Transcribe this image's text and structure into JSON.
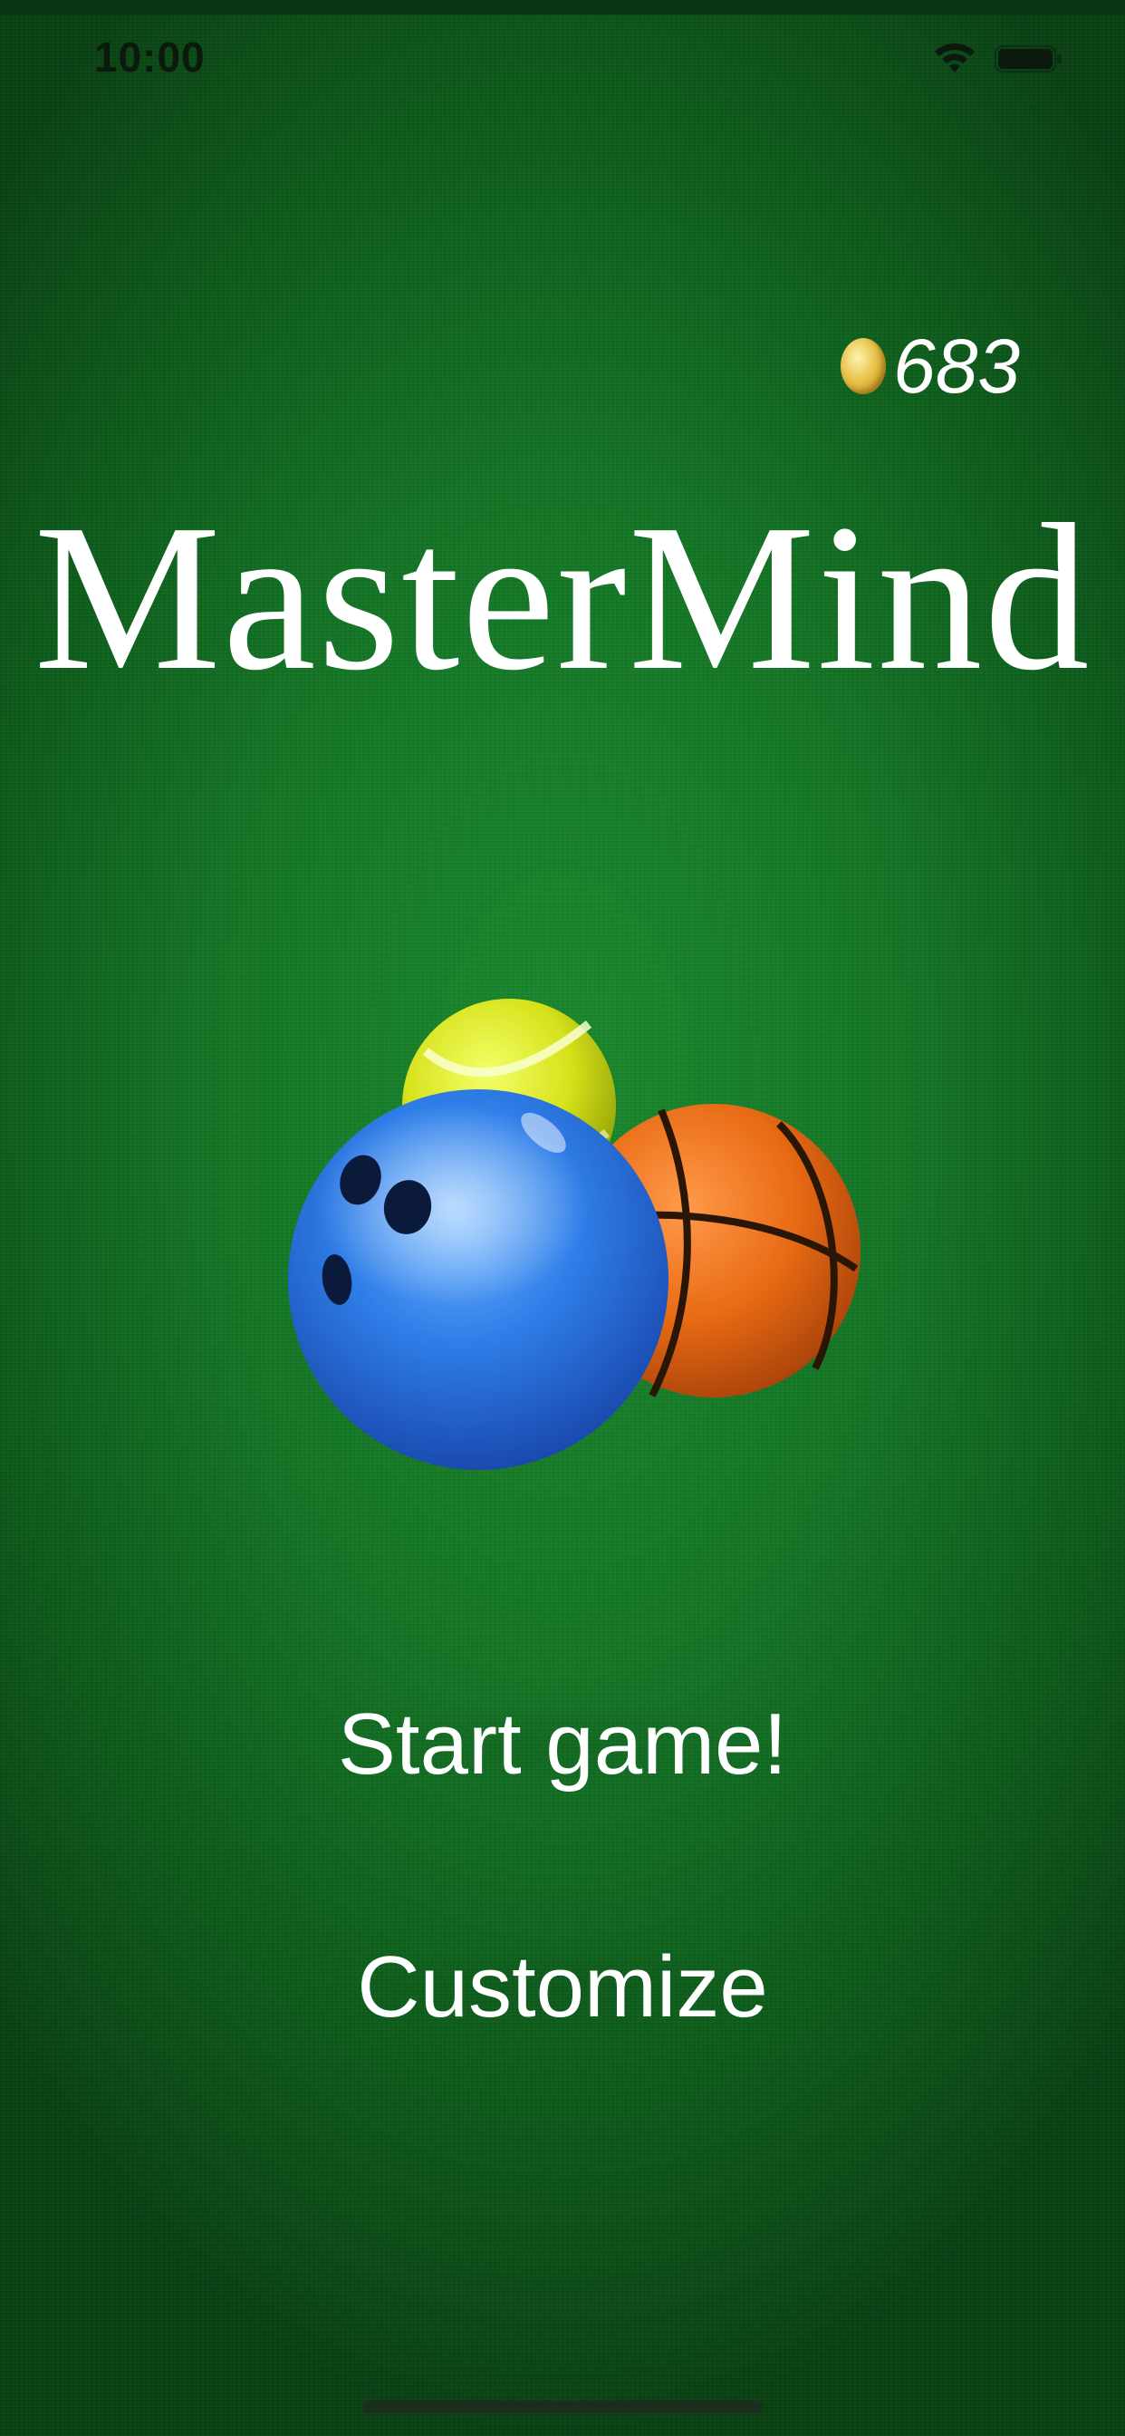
{
  "status_bar": {
    "time": "10:00",
    "icons": [
      "wifi-icon",
      "battery-icon"
    ]
  },
  "header": {
    "coin_icon": "coin-icon",
    "coin_count": "683"
  },
  "app": {
    "title": "MasterMind"
  },
  "illustration": {
    "icons": [
      "tennis-ball-icon",
      "bowling-ball-icon",
      "basketball-icon"
    ]
  },
  "menu": {
    "start_label": "Start game!",
    "customize_label": "Customize"
  },
  "colors": {
    "felt_green": "#137425",
    "text": "#ffffff",
    "coin_gold": "#e8c24a"
  }
}
